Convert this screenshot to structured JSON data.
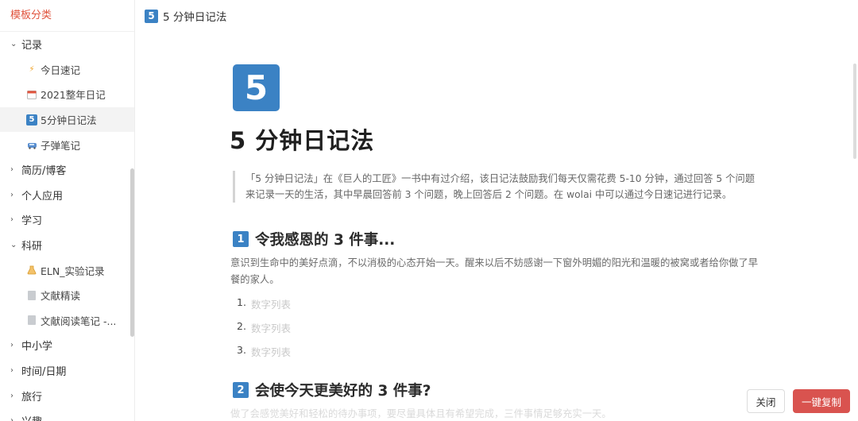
{
  "sidebar": {
    "title": "模板分类",
    "groups": [
      {
        "label": "记录",
        "expanded": true,
        "items": [
          {
            "label": "今日速记",
            "icon": "lightning-icon"
          },
          {
            "label": "2021整年日记",
            "icon": "calendar-icon"
          },
          {
            "label": "5分钟日记法",
            "icon": "number-5-icon"
          },
          {
            "label": "子弹笔记",
            "icon": "train-icon"
          }
        ]
      },
      {
        "label": "简历/博客",
        "expanded": false
      },
      {
        "label": "个人应用",
        "expanded": false
      },
      {
        "label": "学习",
        "expanded": false
      },
      {
        "label": "科研",
        "expanded": true,
        "items": [
          {
            "label": "ELN_实验记录",
            "icon": "flask-icon"
          },
          {
            "label": "文献精读",
            "icon": "document-icon"
          },
          {
            "label": "文献阅读笔记 -...",
            "icon": "document-icon"
          }
        ]
      },
      {
        "label": "中小学",
        "expanded": false
      },
      {
        "label": "时间/日期",
        "expanded": false
      },
      {
        "label": "旅行",
        "expanded": false
      },
      {
        "label": "兴趣",
        "expanded": false
      }
    ]
  },
  "header": {
    "icon_char": "5",
    "title": "5 分钟日记法"
  },
  "page": {
    "icon_char": "5",
    "title": "5 分钟日记法",
    "quote": "「5 分钟日记法」在《巨人的工匠》一书中有过介绍，该日记法鼓励我们每天仅需花费 5-10 分钟，通过回答 5 个问题来记录一天的生活，其中早晨回答前 3 个问题，晚上回答后 2 个问题。在 wolai 中可以通过今日速记进行记录。",
    "section1": {
      "num": "1",
      "heading": "令我感恩的 3 件事...",
      "paragraph": "意识到生命中的美好点滴，不以消极的心态开始一天。醒来以后不妨感谢一下窗外明媚的阳光和温暖的被窝或者给你做了早餐的家人。",
      "list": [
        {
          "num": "1.",
          "placeholder": "数字列表"
        },
        {
          "num": "2.",
          "placeholder": "数字列表"
        },
        {
          "num": "3.",
          "placeholder": "数字列表"
        }
      ]
    },
    "section2": {
      "num": "2",
      "heading": "会使今天更美好的 3 件事?",
      "paragraph": "做了会感觉美好和轻松的待办事项，要尽量具体且有希望完成，三件事情足够充实一天。"
    }
  },
  "buttons": {
    "close": "关闭",
    "copy": "一键复制"
  },
  "colors": {
    "accent": "#3b82c4",
    "sidebar_title": "#e0533c",
    "primary_button": "#d9534f"
  }
}
